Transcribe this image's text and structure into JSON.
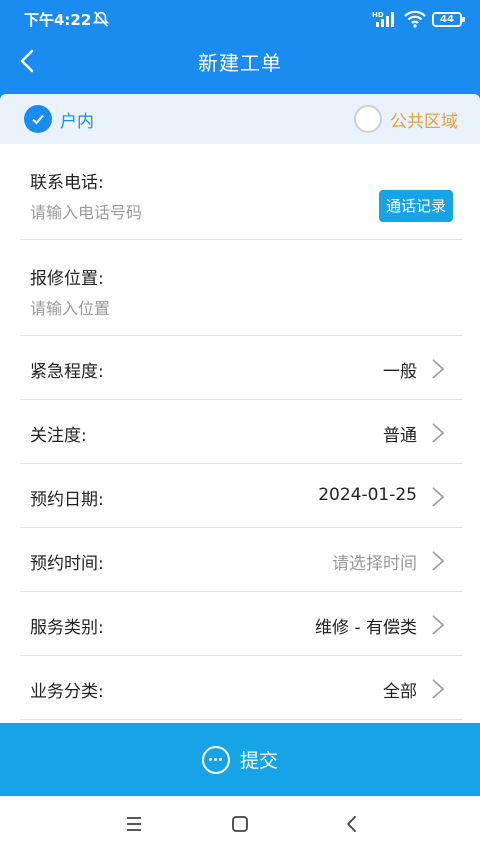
{
  "status_bar": {
    "time": "下午4:22",
    "battery": "44",
    "network_label": "HD"
  },
  "header": {
    "title": "新建工单"
  },
  "segment": {
    "option_indoor": "户内",
    "option_public": "公共区域",
    "selected": "户内"
  },
  "form": {
    "phone": {
      "label": "联系电话:",
      "placeholder": "请输入电话号码",
      "call_log_button": "通话记录"
    },
    "location": {
      "label": "报修位置:",
      "placeholder": "请输入位置"
    },
    "rows": [
      {
        "label": "紧急程度:",
        "value": "一般",
        "placeholder": false
      },
      {
        "label": "关注度:",
        "value": "普通",
        "placeholder": false
      },
      {
        "label": "预约日期:",
        "value": "2024-01-25",
        "placeholder": false
      },
      {
        "label": "预约时间:",
        "value": "请选择时间",
        "placeholder": true
      },
      {
        "label": "服务类别:",
        "value": "维修 - 有偿类",
        "placeholder": false
      },
      {
        "label": "业务分类:",
        "value": "全部",
        "placeholder": false
      }
    ]
  },
  "submit": {
    "label": "提交"
  },
  "colors": {
    "primary": "#1a8cf0",
    "submit": "#16a4e6",
    "accent_orange": "#e6a23c"
  }
}
